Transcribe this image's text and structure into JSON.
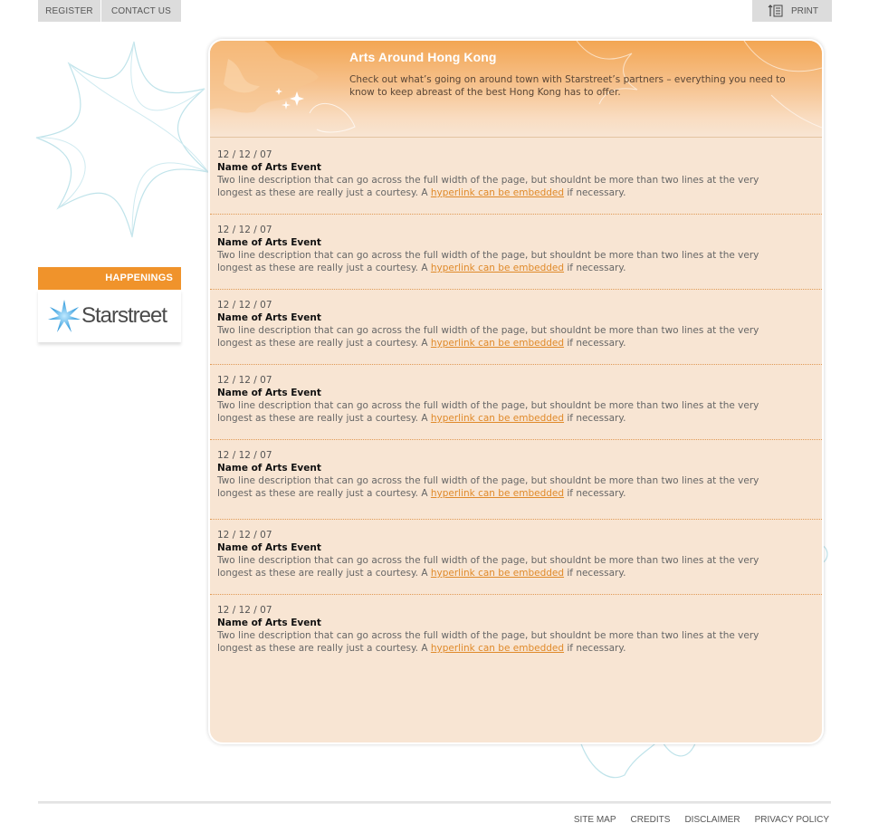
{
  "topnav": {
    "register": "REGISTER",
    "contact": "CONTACT US",
    "print": "PRINT"
  },
  "sidebar": {
    "happenings": "HAPPENINGS",
    "logo_text": "Starstreet"
  },
  "banner": {
    "title": "Arts Around Hong Kong",
    "intro": "Check out what’s going on around town with Starstreet’s partners – everything you need to know to keep abreast of the best Hong Kong has to offer."
  },
  "events": [
    {
      "date": "12 / 12 / 07",
      "name": "Name of Arts Event",
      "desc_before": "Two line description that can go across the full width of the page, but shouldnt be more than two lines at the very longest as these are really just a courtesy. A ",
      "link": "hyperlink can be embedded",
      "desc_after": " if necessary."
    },
    {
      "date": "12 / 12 / 07",
      "name": "Name of Arts Event",
      "desc_before": "Two line description that can go across the full width of the page, but shouldnt be more than two lines at the very longest as these are really just a courtesy. A ",
      "link": "hyperlink can be embedded",
      "desc_after": " if necessary."
    },
    {
      "date": "12 / 12 / 07",
      "name": "Name of Arts Event",
      "desc_before": "Two line description that can go across the full width of the page, but shouldnt be more than two lines at the very longest as these are really just a courtesy. A ",
      "link": "hyperlink can be embedded",
      "desc_after": " if necessary."
    },
    {
      "date": "12 / 12 / 07",
      "name": "Name of Arts Event",
      "desc_before": "Two line description that can go across the full width of the page, but shouldnt be more than two lines at the very longest as these are really just a courtesy. A ",
      "link": "hyperlink can be embedded",
      "desc_after": " if necessary."
    },
    {
      "date": "12 / 12 / 07",
      "name": "Name of Arts Event",
      "desc_before": "Two line description that can go across the full width of the page, but shouldnt be more than two lines at the very longest as these are really just a courtesy. A ",
      "link": "hyperlink can be embedded",
      "desc_after": " if necessary."
    },
    {
      "date": "12 / 12 / 07",
      "name": "Name of Arts Event",
      "desc_before": "Two line description that can go across the full width of the page, but shouldnt be more than two lines at the very longest as these are really just a courtesy. A ",
      "link": "hyperlink can be embedded",
      "desc_after": " if necessary."
    },
    {
      "date": "12 / 12 / 07",
      "name": "Name of Arts Event",
      "desc_before": "Two line description that can go across the full width of the page, but shouldnt be more than two lines at the very longest as these are really just a courtesy. A ",
      "link": "hyperlink can be embedded",
      "desc_after": " if necessary."
    }
  ],
  "footer": {
    "sitemap": "SITE MAP",
    "credits": "CREDITS",
    "disclaimer": "DISCLAIMER",
    "privacy": "PRIVACY POLICY"
  },
  "colors": {
    "accent": "#f0932b",
    "panel": "#f8e5d3",
    "link": "#e08a2a",
    "star_outline": "#bfe3ea"
  }
}
